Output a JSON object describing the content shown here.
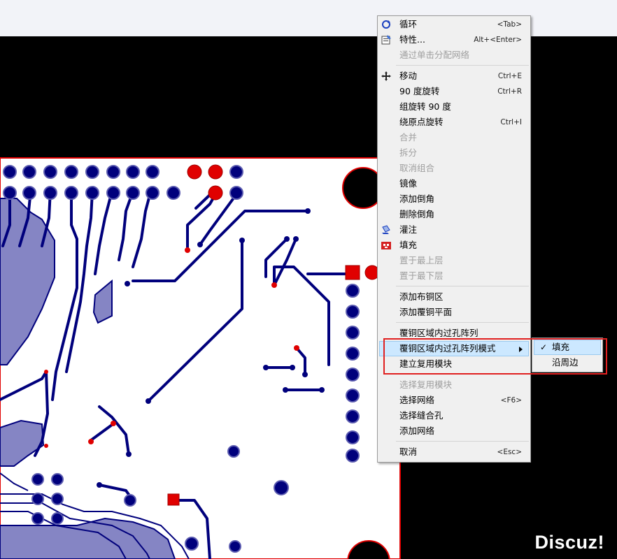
{
  "watermark": "Discuz!",
  "context_menu": {
    "items": [
      {
        "label": "循环",
        "shortcut": "<Tab>",
        "icon": "cycle-icon",
        "disabled": false
      },
      {
        "label": "特性...",
        "shortcut": "Alt+<Enter>",
        "icon": "properties-icon",
        "disabled": false
      },
      {
        "label": "通过单击分配网络",
        "shortcut": "",
        "disabled": true
      },
      {
        "label": "移动",
        "shortcut": "Ctrl+E",
        "icon": "move-icon",
        "disabled": false
      },
      {
        "label": "90 度旋转",
        "shortcut": "Ctrl+R",
        "disabled": false
      },
      {
        "label": "组旋转 90 度",
        "shortcut": "",
        "disabled": false
      },
      {
        "label": "绕原点旋转",
        "shortcut": "Ctrl+I",
        "disabled": false
      },
      {
        "label": "合并",
        "shortcut": "",
        "disabled": true
      },
      {
        "label": "拆分",
        "shortcut": "",
        "disabled": true
      },
      {
        "label": "取消组合",
        "shortcut": "",
        "disabled": true
      },
      {
        "label": "镜像",
        "shortcut": "",
        "disabled": false
      },
      {
        "label": "添加倒角",
        "shortcut": "",
        "disabled": false
      },
      {
        "label": "删除倒角",
        "shortcut": "",
        "disabled": false
      },
      {
        "label": "灌注",
        "shortcut": "",
        "icon": "pour-icon",
        "disabled": false
      },
      {
        "label": "填充",
        "shortcut": "",
        "icon": "fill-icon",
        "disabled": false
      },
      {
        "label": "置于最上层",
        "shortcut": "",
        "disabled": true
      },
      {
        "label": "置于最下层",
        "shortcut": "",
        "disabled": true
      },
      {
        "label": "添加布铜区",
        "shortcut": "",
        "disabled": false
      },
      {
        "label": "添加覆铜平面",
        "shortcut": "",
        "disabled": false
      },
      {
        "label": "覆铜区域内过孔阵列",
        "shortcut": "",
        "disabled": false
      },
      {
        "label": "覆铜区域内过孔阵列模式",
        "shortcut": "",
        "disabled": false,
        "submenu": true
      },
      {
        "label": "建立复用模块",
        "shortcut": "",
        "disabled": false
      },
      {
        "label": "选择复用模块",
        "shortcut": "",
        "disabled": true
      },
      {
        "label": "选择网络",
        "shortcut": "<F6>",
        "disabled": false
      },
      {
        "label": "选择缝合孔",
        "shortcut": "",
        "disabled": false
      },
      {
        "label": "添加网络",
        "shortcut": "",
        "disabled": false
      },
      {
        "label": "取消",
        "shortcut": "<Esc>",
        "disabled": false
      }
    ]
  },
  "submenu": {
    "items": [
      {
        "label": "填充",
        "checked": true
      },
      {
        "label": "沿周边",
        "checked": false
      }
    ]
  },
  "colors": {
    "board": "#ffffff",
    "trace": "#00007c",
    "copper_pour": "#8585c4",
    "outline": "#e00000",
    "background": "#000000"
  }
}
